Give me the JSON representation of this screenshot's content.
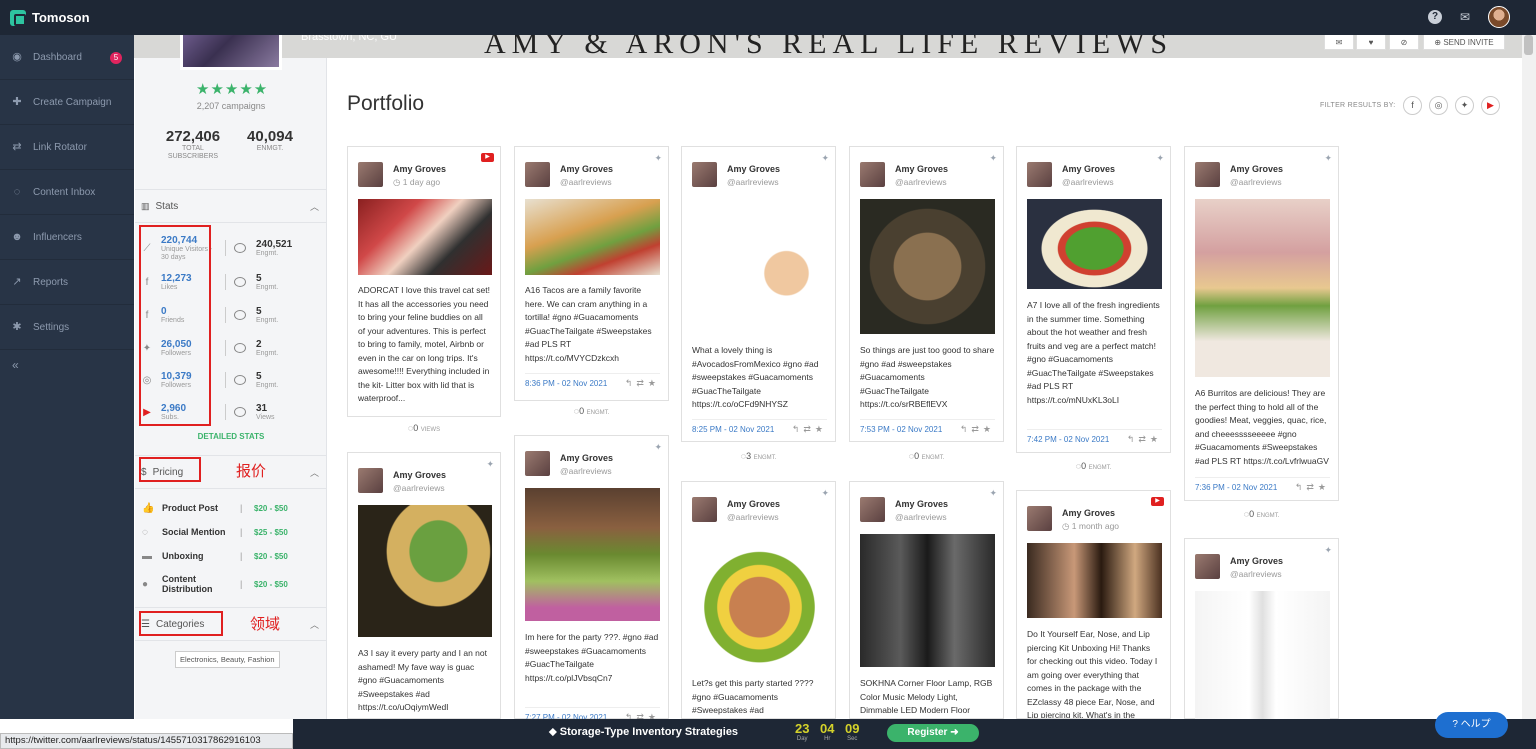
{
  "app": {
    "brand": "Tomoson"
  },
  "sidebar": {
    "items": [
      {
        "label": "Dashboard",
        "icon": "dashboard-icon",
        "badge": "5"
      },
      {
        "label": "Create Campaign",
        "icon": "plus-icon"
      },
      {
        "label": "Link Rotator",
        "icon": "rotate-icon"
      },
      {
        "label": "Content Inbox",
        "icon": "chat-icon"
      },
      {
        "label": "Influencers",
        "icon": "users-icon"
      },
      {
        "label": "Reports",
        "icon": "chart-icon"
      },
      {
        "label": "Settings",
        "icon": "gear-icon"
      }
    ],
    "collapse": "«"
  },
  "cover": {
    "title": "AMY & ARON'S REAL LIFE REVIEWS",
    "location": "Brasstown, NC, GU",
    "send_invite": "SEND INVITE"
  },
  "profile": {
    "stars": "★★★★★",
    "campaigns": "2,207 campaigns",
    "subscribers": {
      "value": "272,406",
      "label1": "TOTAL",
      "label2": "SUBSCRIBERS"
    },
    "engagement": {
      "value": "40,094",
      "label": "ENMGT."
    }
  },
  "stats": {
    "title": "Stats",
    "rows": [
      {
        "icon": "trend-icon",
        "value": "220,744",
        "label": "Unique Visitors - 30 days",
        "eng": "240,521",
        "eng_label": "Engmt."
      },
      {
        "icon": "facebook-icon",
        "value": "12,273",
        "label": "Likes",
        "eng": "5",
        "eng_label": "Engmt."
      },
      {
        "icon": "facebook-icon",
        "value": "0",
        "label": "Friends",
        "eng": "5",
        "eng_label": "Engmt."
      },
      {
        "icon": "twitter-icon",
        "value": "26,050",
        "label": "Followers",
        "eng": "2",
        "eng_label": "Engmt."
      },
      {
        "icon": "instagram-icon",
        "value": "10,379",
        "label": "Followers",
        "eng": "5",
        "eng_label": "Engmt."
      },
      {
        "icon": "youtube-icon",
        "value": "2,960",
        "label": "Subs.",
        "eng": "31",
        "eng_label": "Views"
      }
    ],
    "detailed": "DETAILED STATS"
  },
  "pricing": {
    "title": "Pricing",
    "rows": [
      {
        "name": "Product Post",
        "sep": "|",
        "value": "$20 - $50"
      },
      {
        "name": "Social Mention",
        "sep": "|",
        "value": "$25 - $50"
      },
      {
        "name": "Unboxing",
        "sep": "|",
        "value": "$20 - $50"
      },
      {
        "name": "Content Distribution",
        "sep": "|",
        "value": "$20 - $50"
      }
    ]
  },
  "categories": {
    "title": "Categories",
    "tag": "Electronics, Beauty, Fashion"
  },
  "annotations": {
    "pricing_cn": "报价",
    "categories_cn": "领域"
  },
  "main": {
    "title": "Portfolio",
    "filter_label": "FILTER RESULTS BY:"
  },
  "cards": [
    {
      "name": "Amy Groves",
      "handle": "1 day ago",
      "net": "yt",
      "text": "ADORCAT I love this travel cat set! It has all the accessories you need to bring your feline buddies on all of your adventures. This is perfect to bring to family, motel, Airbnb or even in the car on long trips. It's awesome!!!! Everything included in the kit- Litter box with lid that is waterproof...",
      "foot": "",
      "eng": "0",
      "eng_lbl": "VIEWS"
    },
    {
      "name": "Amy Groves",
      "handle": "@aarlreviews",
      "net": "tw",
      "text": "A16 Tacos are a family favorite here. We can cram anything in a tortilla! #gno #Guacamoments #GuacTheTailgate #Sweepstakes #ad PLS RT https://t.co/MVYCDzkcxh",
      "foot": "8:36 PM - 02 Nov 2021",
      "eng": "0",
      "eng_lbl": "ENGMT."
    },
    {
      "name": "Amy Groves",
      "handle": "@aarlreviews",
      "net": "tw",
      "text": "What a lovely thing is #AvocadosFromMexico #gno #ad #sweepstakes #Guacamoments #GuacTheTailgate https://t.co/oCFd9NHYSZ",
      "foot": "8:25 PM - 02 Nov 2021",
      "eng": "3",
      "eng_lbl": "ENGMT."
    },
    {
      "name": "Amy Groves",
      "handle": "@aarlreviews",
      "net": "tw",
      "text": "So things are just too good to share #gno #ad #sweepstakes #Guacamoments #GuacTheTailgate https://t.co/srRBEflEVX",
      "foot": "7:53 PM - 02 Nov 2021",
      "eng": "0",
      "eng_lbl": "ENGMT."
    },
    {
      "name": "Amy Groves",
      "handle": "@aarlreviews",
      "net": "tw",
      "text": "A7 I love all of the fresh ingredients in the summer time. Something about the hot weather and fresh fruits and veg are a perfect match! #gno #Guacamoments #GuacTheTailgate #Sweepstakes #ad PLS RT https://t.co/mNUxKL3oLI",
      "foot": "7:42 PM - 02 Nov 2021",
      "eng": "0",
      "eng_lbl": "ENGMT."
    },
    {
      "name": "Amy Groves",
      "handle": "@aarlreviews",
      "net": "tw",
      "text": "A6 Burritos are delicious! They are the perfect thing to hold all of the goodies! Meat, veggies, quac, rice, and cheeesssseeeee #gno #Guacamoments #Sweepstakes #ad PLS RT https://t.co/LvfrlwuaGV",
      "foot": "7:36 PM - 02 Nov 2021",
      "eng": "0",
      "eng_lbl": "ENGMT."
    },
    {
      "name": "Amy Groves",
      "handle": "@aarlreviews",
      "net": "tw",
      "text": "A3 I say it every party and I an not ashamed! My fave way is guac #gno #Guacamoments #Sweepstakes #ad https://t.co/uOqiymWedI"
    },
    {
      "name": "Amy Groves",
      "handle": "@aarlreviews",
      "net": "tw",
      "text": "Im here for the party ???. #gno #ad #sweepstakes #Guacamoments #GuacTheTailgate https://t.co/plJVbsqCn7",
      "foot": "7:27 PM - 02 Nov 2021"
    },
    {
      "name": "Amy Groves",
      "handle": "@aarlreviews",
      "net": "tw",
      "text": "Let?s get this party started ???? #gno #Guacamoments #Sweepstakes #ad"
    },
    {
      "name": "Amy Groves",
      "handle": "@aarlreviews",
      "net": "tw",
      "text": "SOKHNA Corner Floor Lamp, RGB Color Music Melody Light, Dimmable LED Modern Floor"
    },
    {
      "name": "Amy Groves",
      "handle": "1 month ago",
      "net": "yt",
      "text": "Do It Yourself Ear, Nose, and Lip piercing Kit Unboxing Hi! Thanks for checking out this video. Today I am going over everything that comes in the package with the EZclassy 48 piece Ear, Nose, and Lip piercing kit. What's in the"
    },
    {
      "name": "Amy Groves",
      "handle": "@aarlreviews",
      "net": "tw",
      "text": ""
    }
  ],
  "statusbar": {
    "url": "https://twitter.com/aarlreviews/status/1455710317862916103"
  },
  "promo": {
    "title": "Storage-Type Inventory Strategies",
    "days": "23",
    "days_lbl": "Day",
    "hours": "04",
    "hours_lbl": "Hr",
    "secs": "09",
    "secs_lbl": "Sec",
    "register": "Register ➜"
  },
  "help": {
    "label": "ヘルプ"
  }
}
